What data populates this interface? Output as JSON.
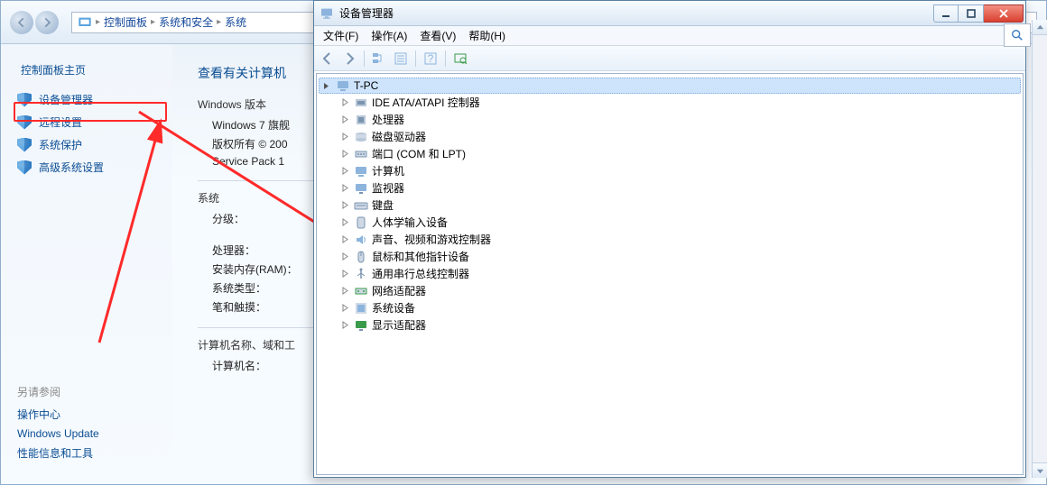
{
  "cp": {
    "breadcrumbs": [
      "控制面板",
      "系统和安全",
      "系统"
    ],
    "sidebar_title": "控制面板主页",
    "sidebar_items": [
      {
        "label": "设备管理器"
      },
      {
        "label": "远程设置"
      },
      {
        "label": "系统保护"
      },
      {
        "label": "高级系统设置"
      }
    ],
    "main_heading": "查看有关计算机",
    "win_version_label": "Windows 版本",
    "win_version_line1": "Windows 7 旗舰",
    "win_version_line2": "版权所有 © 200",
    "win_version_line3": "Service Pack 1",
    "system_label": "系统",
    "system_rows": [
      "分级：",
      "处理器：",
      "安装内存(RAM)：",
      "系统类型：",
      "笔和触摸："
    ],
    "computer_name_label": "计算机名称、域和工",
    "computer_name_row": "计算机名：",
    "see_also_title": "另请参阅",
    "see_also_items": [
      "操作中心",
      "Windows Update",
      "性能信息和工具"
    ]
  },
  "dm": {
    "title": "设备管理器",
    "menus": [
      "文件(F)",
      "操作(A)",
      "查看(V)",
      "帮助(H)"
    ],
    "root": "T-PC",
    "nodes": [
      {
        "label": "IDE ATA/ATAPI 控制器",
        "icon": "ide"
      },
      {
        "label": "处理器",
        "icon": "cpu"
      },
      {
        "label": "磁盘驱动器",
        "icon": "disk"
      },
      {
        "label": "端口 (COM 和 LPT)",
        "icon": "port"
      },
      {
        "label": "计算机",
        "icon": "computer"
      },
      {
        "label": "监视器",
        "icon": "monitor"
      },
      {
        "label": "键盘",
        "icon": "keyboard"
      },
      {
        "label": "人体学输入设备",
        "icon": "hid"
      },
      {
        "label": "声音、视频和游戏控制器",
        "icon": "sound"
      },
      {
        "label": "鼠标和其他指针设备",
        "icon": "mouse"
      },
      {
        "label": "通用串行总线控制器",
        "icon": "usb"
      },
      {
        "label": "网络适配器",
        "icon": "network"
      },
      {
        "label": "系统设备",
        "icon": "system"
      },
      {
        "label": "显示适配器",
        "icon": "display"
      }
    ]
  }
}
